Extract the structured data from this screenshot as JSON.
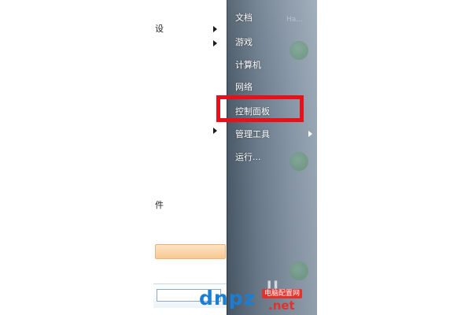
{
  "left_pane": {
    "items": [
      {
        "label": "设",
        "has_arrow": true
      },
      {
        "label": "",
        "has_arrow": true
      },
      {
        "label": "",
        "has_arrow": true
      },
      {
        "label": "件",
        "has_arrow": false
      }
    ]
  },
  "right_pane": {
    "top_faint_text": "Ha...",
    "items": [
      {
        "label": "文档",
        "has_arrow": false
      },
      {
        "label": "游戏",
        "has_arrow": false
      },
      {
        "label": "计算机",
        "has_arrow": false
      },
      {
        "label": "网络",
        "has_arrow": false
      },
      {
        "label": "控制面板",
        "has_arrow": false,
        "highlighted": true
      },
      {
        "label": "管理工具",
        "has_arrow": true
      },
      {
        "label": "运行...",
        "has_arrow": false
      }
    ],
    "pause_glyph": "❚❚"
  },
  "watermark": {
    "brand": "dnpz",
    "dot": ".",
    "net": "net",
    "badge": "电脑配置网"
  },
  "colors": {
    "highlight_box": "#e8111a",
    "right_pane_bg": "#6d7d8d",
    "watermark_blue": "#1a7fd4",
    "watermark_red": "#e3312b"
  }
}
